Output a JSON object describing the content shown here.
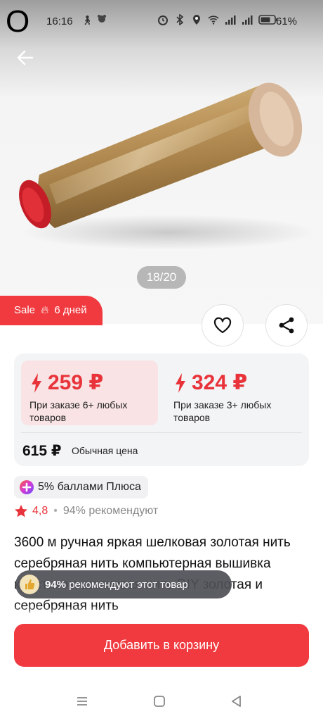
{
  "status": {
    "logo": "O",
    "time": "16:16",
    "battery_pct": "61%"
  },
  "gallery": {
    "pager": "18/20"
  },
  "sale": {
    "label": "Sale",
    "icon": "fire-icon",
    "duration": "6 дней"
  },
  "pricing": {
    "tiers": [
      {
        "price": "259 ₽",
        "note": "При заказе 6+ любых товаров"
      },
      {
        "price": "324 ₽",
        "note": "При заказе 3+ любых товаров"
      }
    ],
    "regular_price": "615 ₽",
    "regular_label": "Обычная цена"
  },
  "plus": {
    "label": "5% баллами Плюса"
  },
  "rating": {
    "value": "4,8",
    "recommend": "94% рекомендуют"
  },
  "product": {
    "title": "3600 м ручная яркая шелковая золотая нить серебряная нить компьютерная вышивка крестиком шелковая нить DIY золотая и серебряная нить"
  },
  "tooltip": {
    "percent": "94%",
    "text": "рекомендуют этот товар"
  },
  "cart": {
    "label": "Добавить в корзину"
  },
  "colors": {
    "accent": "#f03a3f",
    "price_red": "#e8333a",
    "tier_bg": "#f9e3e4",
    "card_bg": "#f3f4f6"
  }
}
